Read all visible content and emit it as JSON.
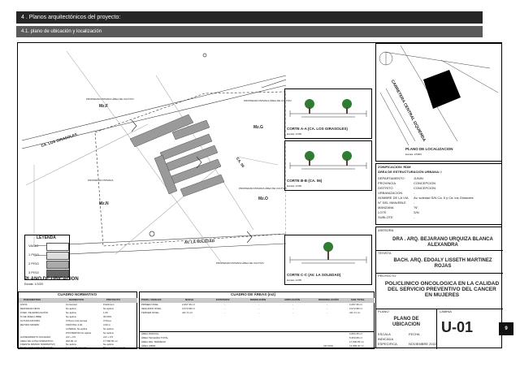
{
  "header": {
    "title": "4 . Planos arquitectónicos del proyecto:",
    "subtitle": "4.1. plano de ubicación y localización"
  },
  "page_number": "9",
  "site_plan": {
    "streets": [
      "CA. LOS GIRASOLES",
      "AV. LA SOLEDAD",
      "CA. 06"
    ],
    "lot_labels": [
      "Mz.F",
      "Mz.G",
      "Mz.N",
      "Mz.O"
    ],
    "property_notes": [
      "PROPIEDAD PRIVADA ÁREA DE CULTIVO",
      "PROPIEDAD PRIVADA ÁREA DE CULTIVO",
      "PROPIEDAD PRIVADA",
      "PROPIEDAD PRIVADA ÁREA DE CULTIVO",
      "PROPIEDAD PRIVADA ÁREA DE CULTIVO"
    ],
    "title": "PLANO DE UBICACION",
    "scale": "Escala: 1/1000"
  },
  "legend": {
    "title": "LEYENDA",
    "items": [
      "VACIO",
      "1 PISO",
      "2 PISO",
      "3 PISO"
    ]
  },
  "sections": [
    {
      "title": "CORTE A-A (CA. LOS GIRASOLES)",
      "scale": "Escala: 1/250"
    },
    {
      "title": "CORTE B-B (CA. 06)",
      "scale": "Escala: 1/250"
    },
    {
      "title": "CORTE C-C (AV. LA SOLEDAD)",
      "scale": "Escala: 1/250"
    }
  ],
  "location": {
    "road": "CARRETERA CENTRAL IZQUIERDA",
    "title": "PLANO DE LOCALIZACION",
    "scale": "Escala: 1/5000"
  },
  "zoning": {
    "title1": "ZONIFICACION: RDM",
    "title2": "ÁREA DE ESTRUCTURACIÓN URBANA: I",
    "rows": [
      {
        "k": "DEPARTAMENTO",
        "v": "JUNIN"
      },
      {
        "k": "PROVINCIA",
        "v": "CONCEPCION"
      },
      {
        "k": "DISTRITO",
        "v": "CONCEPCION"
      },
      {
        "k": "URBANIZACION",
        "v": "-"
      },
      {
        "k": "NOMBRE DE LA VIA",
        "v": "Av. soledad S/N Ca. 5 y Ca. los Girasoles"
      },
      {
        "k": "N° DEL INMUEBLE",
        "v": "-"
      },
      {
        "k": "MANZANA",
        "v": "\"N\""
      },
      {
        "k": "LOTE",
        "v": "S/N"
      },
      {
        "k": "SUBLOTE",
        "v": "-"
      }
    ]
  },
  "credits": {
    "asesora_label": "ASESORA",
    "asesora": "DRA . ARQ. BEJARANO URQUIZA BLANCA ALEXANDRA",
    "tesista_label": "TESISTA",
    "tesista": "BACH. ARQ. EDOALY LISSETH MARTINEZ ROJAS",
    "proyecto_label": "PROYECTO",
    "proyecto": "POLICLINICO ONCOLOGICA EN LA CALIDAD DEL SERVICIO PREVENTIVO DEL CANCER EN MUJERES",
    "plano_label": "PLANO",
    "plano": "PLANO DE UBICACION",
    "lamina_label": "LAMINA",
    "lamina": "U-01",
    "escala_label": "ESCALA",
    "escala": "INDICADA",
    "fecha_label": "FECHA",
    "fecha": "NOVIEMBRE 2022",
    "especifica": "ESPECIFICA"
  },
  "cuadro_normativo": {
    "title": "CUADRO NORMATIVO",
    "headers": [
      "PARAMETROS",
      "NORMATIVO",
      "PROYECTO"
    ],
    "rows": [
      [
        "USOS",
        "Comercial",
        "Policlínico"
      ],
      [
        "DENSIDAD NETA",
        "No aplica",
        "No aplica"
      ],
      [
        "COEF. DE EDIFICACIÓN",
        "No aplica",
        "1.60"
      ],
      [
        "% DE ÁREA LIBRE",
        "No aplica",
        "30.00%"
      ],
      [
        "ALTURA MAXIMA",
        "3 Pisos más azotea",
        "3 Pisos"
      ],
      [
        "RETIRO MINIMO",
        "FRONTAL  3.00",
        "3.00 m"
      ],
      [
        "",
        "LATERAL  No aplica",
        "No aplica"
      ],
      [
        "",
        "POSTERIOR  No aplica",
        "No aplica"
      ],
      [
        "ALINEAMIENTO FACHADA",
        "A/2 + 0.5",
        "A/2 + 0.5"
      ],
      [
        "AREA DE LOTE NORMATIVO",
        "200.00 m²",
        "17 590.65 m²"
      ],
      [
        "FRENTE MINIMO NORMATIVO",
        "No aplica",
        "No aplica"
      ],
      [
        "N° DE ESTACIONAMIENTOS",
        "1 por cada vivienda",
        "50 por cada vivienda"
      ]
    ]
  },
  "cuadro_areas": {
    "title": "CUADRO DE ÁREAS (m2)",
    "headers": [
      "PISOS / NIVELES",
      "NUEVA",
      "EXISTENTE",
      "DEMOLICIÓN",
      "AMPLIACIÓN",
      "REMODELACIÓN",
      "SUB TOTAL"
    ],
    "rows": [
      [
        "PRIMER NIVEL",
        "2,697.36 m²",
        "-",
        "-",
        "-",
        "-",
        "2,697.36 m²"
      ],
      [
        "SEGUNDO NIVEL",
        "2,072.98 m²",
        "-",
        "-",
        "-",
        "-",
        "2,072.98 m²"
      ],
      [
        "TERCER NIVEL",
        "411.71 m²",
        "-",
        "-",
        "-",
        "-",
        "411.71 m²"
      ]
    ],
    "totals": [
      [
        "ÁREA PARCIAL",
        "2,894.35 m²"
      ],
      [
        "ÁREA TECHADA TOTAL",
        "5,350.08 m²"
      ],
      [
        "ÁREA DEL TERRENO",
        "17,590.65 m²"
      ],
      [
        "ÁREA LIBRE",
        "(30.04%)",
        "14,896.30 m²"
      ]
    ]
  }
}
